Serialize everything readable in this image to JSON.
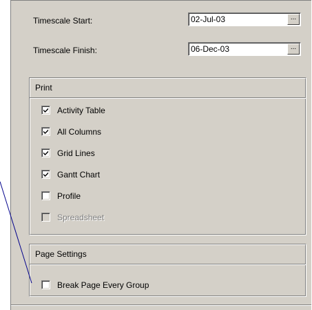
{
  "timescale": {
    "start_label": "Timescale Start:",
    "start_value": "02-Jul-03",
    "finish_label": "Timescale Finish:",
    "finish_value": "06-Dec-03",
    "browse_label": "..."
  },
  "print_group": {
    "title": "Print",
    "items": [
      {
        "label": "Activity Table",
        "checked": true,
        "enabled": true
      },
      {
        "label": "All Columns",
        "checked": true,
        "enabled": true
      },
      {
        "label": "Grid Lines",
        "checked": true,
        "enabled": true
      },
      {
        "label": "Gantt Chart",
        "checked": true,
        "enabled": true
      },
      {
        "label": "Profile",
        "checked": false,
        "enabled": true
      },
      {
        "label": "Spreadsheet",
        "checked": false,
        "enabled": false
      }
    ]
  },
  "page_settings": {
    "title": "Page Settings",
    "break_label": "Break Page Every Group",
    "break_checked": false
  },
  "colors": {
    "panel": "#d4d0c8",
    "pointer_line": "#00008b"
  }
}
